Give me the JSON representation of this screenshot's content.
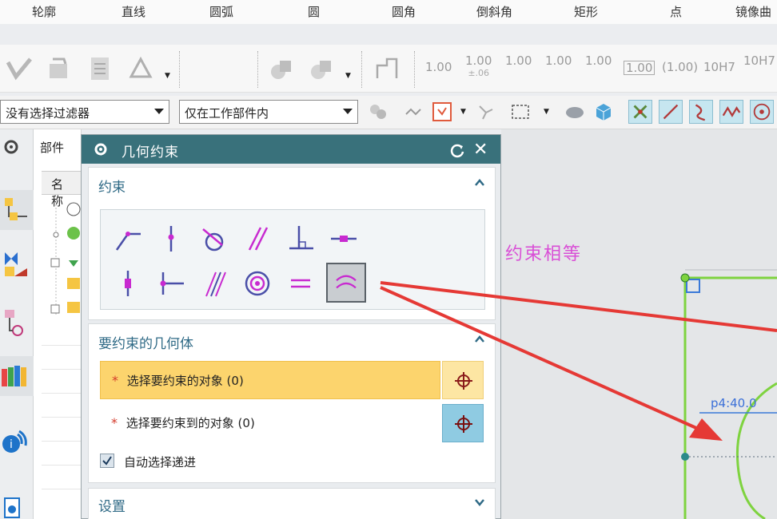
{
  "menu": {
    "items": [
      "轮廓",
      "直线",
      "圆弧",
      "圆",
      "圆角",
      "倒斜角",
      "矩形",
      "点",
      "镜像曲"
    ]
  },
  "toolbar": {
    "numeric_buttons": [
      {
        "top": "1.00",
        "bottom": ""
      },
      {
        "top": "1.00",
        "bottom": "±.06"
      },
      {
        "top": "1.00",
        "bottom": ""
      },
      {
        "top": "1.00",
        "bottom": ""
      },
      {
        "top": "1.00",
        "bottom": ""
      },
      {
        "top": "1.00",
        "bottom": ""
      },
      {
        "top": "(1.00)",
        "bottom": ""
      },
      {
        "top": "10H7",
        "bottom": ""
      },
      {
        "top": "10H7",
        "bottom": ""
      }
    ]
  },
  "filter": {
    "type_filter": "没有选择过滤器",
    "scope_filter": "仅在工作部件内"
  },
  "navigator": {
    "tab_label": "部件",
    "column_header": "名称"
  },
  "dialog": {
    "title": "几何约束",
    "constraint_section": {
      "title": "约束"
    },
    "geometry_section": {
      "title": "要约束的几何体",
      "row1": {
        "required": "*",
        "label": "选择要约束的对象 (0)"
      },
      "row2": {
        "required": "*",
        "label": "选择要约束到的对象 (0)"
      },
      "auto_advance_label": "自动选择递进",
      "auto_advance_checked": true
    },
    "settings_section": {
      "title": "设置"
    }
  },
  "canvas": {
    "annotation": "约束相等",
    "dimension_label": "p4:40.0"
  },
  "colors": {
    "dialog_title_bg": "#39717b",
    "section_heading": "#2f6a86",
    "active_row": "#fcd46d",
    "annotation": "#d94fd6",
    "sketch_green": "#7ed33f",
    "arrow_red": "#e53935",
    "constraint_icon_magenta": "#c82ad0",
    "constraint_icon_navy": "#4a4fa8"
  }
}
